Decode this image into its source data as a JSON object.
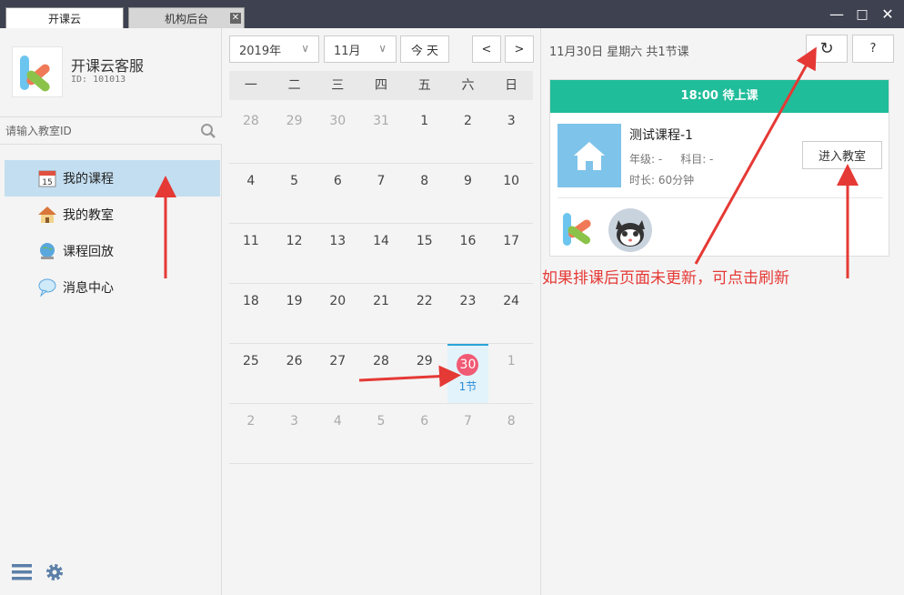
{
  "tabs": [
    {
      "label": "开课云"
    },
    {
      "label": "机构后台"
    }
  ],
  "window": {
    "minimize": "—",
    "maximize": "□",
    "close": "✕"
  },
  "sidebar": {
    "app_name": "开课云客服",
    "app_id": "ID: 101013",
    "search_placeholder": "请输入教室ID",
    "items": [
      {
        "label": "我的课程",
        "icon": "calendar-icon"
      },
      {
        "label": "我的教室",
        "icon": "house-icon"
      },
      {
        "label": "课程回放",
        "icon": "globe-icon"
      },
      {
        "label": "消息中心",
        "icon": "speech-bubble-icon"
      }
    ]
  },
  "calendar": {
    "year": "2019年",
    "month": "11月",
    "today_btn": "今 天",
    "prev": "<",
    "next": ">",
    "weekdays": [
      "一",
      "二",
      "三",
      "四",
      "五",
      "六",
      "日"
    ],
    "weeks": [
      [
        "28",
        "29",
        "30",
        "31",
        "1",
        "2",
        "3"
      ],
      [
        "4",
        "5",
        "6",
        "7",
        "8",
        "9",
        "10"
      ],
      [
        "11",
        "12",
        "13",
        "14",
        "15",
        "16",
        "17"
      ],
      [
        "18",
        "19",
        "20",
        "21",
        "22",
        "23",
        "24"
      ],
      [
        "25",
        "26",
        "27",
        "28",
        "29",
        "30",
        "1"
      ],
      [
        "2",
        "3",
        "4",
        "5",
        "6",
        "7",
        "8"
      ]
    ],
    "today_count": "1节"
  },
  "detail": {
    "date_line": "11月30日 星期六 共1节课",
    "refresh": "↻",
    "help": "?",
    "card": {
      "header": "18:00  待上课",
      "title": "测试课程-1",
      "grade": "年级: -",
      "subject": "科目: -",
      "duration": "时长: 60分钟",
      "enter": "进入教室"
    }
  },
  "annotation": "如果排课后页面未更新，可点击刷新",
  "colors": {
    "accent": "#20bd9a",
    "today": "#f05a74",
    "active_nav": "#c3def0",
    "arrow": "#e53935"
  }
}
